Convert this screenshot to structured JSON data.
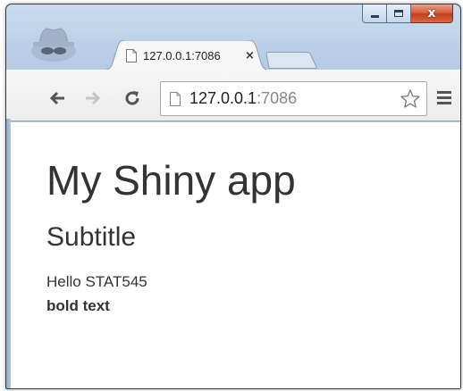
{
  "window": {
    "caption_buttons": {
      "minimize_icon": "minimize-icon",
      "maximize_icon": "maximize-icon",
      "close_glyph": "x"
    },
    "incognito_icon": "incognito-icon"
  },
  "tab": {
    "title": "127.0.0.1:7086",
    "close_glyph": "×",
    "favicon": "page-icon"
  },
  "toolbar": {
    "back_icon": "back-arrow-icon",
    "forward_icon": "forward-arrow-icon",
    "reload_icon": "reload-icon",
    "url_host": "127.0.0.1",
    "url_port": ":7086",
    "bookmark_icon": "star-icon",
    "menu_icon": "hamburger-menu-icon"
  },
  "page": {
    "title": "My Shiny app",
    "subtitle": "Subtitle",
    "text": "Hello STAT545",
    "bold_text": "bold text"
  },
  "colors": {
    "frame": "#b7cde6",
    "close_button": "#c9452a",
    "text": "#333333"
  }
}
